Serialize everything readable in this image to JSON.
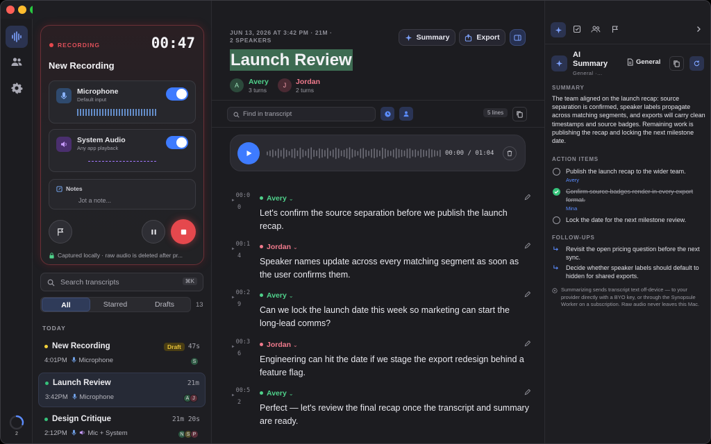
{
  "rail": {
    "icons": [
      "waveform-icon",
      "people-icon",
      "gear-icon"
    ],
    "progress_count": "2"
  },
  "recorder": {
    "status": "RECORDING",
    "timer": "00:47",
    "title": "New Recording",
    "microphone": {
      "label": "Microphone",
      "sub": "Default input",
      "on": true
    },
    "system_audio": {
      "label": "System Audio",
      "sub": "Any app playback",
      "on": true
    },
    "notes": {
      "label": "Notes",
      "placeholder": "Jot a note..."
    },
    "footer": "Captured locally · raw audio is deleted after pr..."
  },
  "search": {
    "placeholder": "Search transcripts",
    "shortcut": "⌘K"
  },
  "filters": {
    "tabs": [
      "All",
      "Starred",
      "Drafts"
    ],
    "active": "All",
    "count": "13"
  },
  "list": {
    "section": "TODAY",
    "items": [
      {
        "title": "New Recording",
        "badge": "Draft",
        "duration": "47s",
        "time": "4:01PM",
        "source": "Microphone",
        "dot": "#f2d13a",
        "avatars": [
          "S"
        ]
      },
      {
        "title": "Launch Review",
        "duration": "21m",
        "time": "3:42PM",
        "source": "Microphone",
        "dot": "#36c27a",
        "avatars": [
          "A",
          "J"
        ]
      },
      {
        "title": "Design Critique",
        "duration": "21m 20s",
        "time": "2:12PM",
        "source": "Mic + System",
        "dot": "#36c27a",
        "avatars": [
          "N",
          "S",
          "P"
        ]
      }
    ]
  },
  "meeting": {
    "meta": "JUN 13, 2026 AT 3:42 PM · 21M ·",
    "meta2": "2 SPEAKERS",
    "title": "Launch Review",
    "speakers": [
      {
        "initial": "A",
        "name": "Avery",
        "turns": "3 turns",
        "color": "#4fd08a"
      },
      {
        "initial": "J",
        "name": "Jordan",
        "turns": "2 turns",
        "color": "#f07a8c"
      }
    ],
    "summary_btn": "Summary",
    "export_btn": "Export"
  },
  "transcript_search": {
    "placeholder": "Find in transcript",
    "lines": "5 lines"
  },
  "player": {
    "current": "00:00",
    "total": "01:04",
    "separator": "/"
  },
  "segments": [
    {
      "ts": "00:0",
      "ts2": "0",
      "speaker": "Avery",
      "color": "#4fd08a",
      "text": "Let's confirm the source separation before we publish the launch recap."
    },
    {
      "ts": "00:1",
      "ts2": "4",
      "speaker": "Jordan",
      "color": "#f07a8c",
      "text": "Speaker names update across every matching segment as soon as the user confirms them."
    },
    {
      "ts": "00:2",
      "ts2": "9",
      "speaker": "Avery",
      "color": "#4fd08a",
      "text": "Can we lock the launch date this week so marketing can start the long-lead comms?"
    },
    {
      "ts": "00:3",
      "ts2": "6",
      "speaker": "Jordan",
      "color": "#f07a8c",
      "text": "Engineering can hit the date if we stage the export redesign behind a feature flag."
    },
    {
      "ts": "00:5",
      "ts2": "2",
      "speaker": "Avery",
      "color": "#4fd08a",
      "text": "Perfect — let's review the final recap once the transcript and summary are ready."
    }
  ],
  "ai": {
    "title1": "AI",
    "title2": "Summary",
    "sub": "General ·…",
    "template": "General",
    "summary_header": "SUMMARY",
    "summary": "The team aligned on the launch recap: source separation is confirmed, speaker labels propagate across matching segments, and exports will carry clean timestamps and source badges. Remaining work is publishing the recap and locking the next milestone date.",
    "actions_header": "ACTION ITEMS",
    "actions": [
      {
        "text": "Publish the launch recap to the wider team.",
        "owner": "Avery",
        "done": false
      },
      {
        "text": "Confirm source badges render in every export format.",
        "owner": "Mina",
        "done": true
      },
      {
        "text": "Lock the date for the next milestone review.",
        "owner": "",
        "done": false
      }
    ],
    "followups_header": "FOLLOW-UPS",
    "followups": [
      "Revisit the open pricing question before the next sync.",
      "Decide whether speaker labels should default to hidden for shared exports."
    ],
    "disclaimer": "Summarizing sends transcript text off-device — to your provider directly with a BYO key, or through the Synopsule Worker on a subscription. Raw audio never leaves this Mac."
  },
  "colors": {
    "accent": "#3e7bff",
    "record": "#e5484d",
    "avery": "#4fd08a",
    "jordan": "#f07a8c"
  }
}
